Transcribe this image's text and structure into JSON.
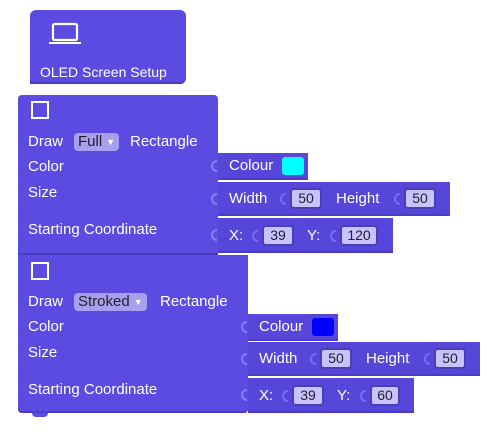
{
  "setup_block": {
    "label": "OLED Screen Setup",
    "icon": "laptop-icon"
  },
  "blocks": [
    {
      "draw_label": "Draw",
      "mode": "Full",
      "shape_label": "Rectangle",
      "color_label": "Color",
      "size_label": "Size",
      "coord_label": "Starting Coordinate",
      "colour_label": "Colour",
      "colour_value": "#00ffff",
      "width_label": "Width",
      "width_value": "50",
      "height_label": "Height",
      "height_value": "50",
      "x_label": "X:",
      "x_value": "39",
      "y_label": "Y:",
      "y_value": "120"
    },
    {
      "draw_label": "Draw",
      "mode": "Stroked",
      "shape_label": "Rectangle",
      "color_label": "Color",
      "size_label": "Size",
      "coord_label": "Starting Coordinate",
      "colour_label": "Colour",
      "colour_value": "#0000ff",
      "width_label": "Width",
      "width_value": "50",
      "height_label": "Height",
      "height_value": "50",
      "x_label": "X:",
      "x_value": "39",
      "y_label": "Y:",
      "y_value": "60"
    }
  ],
  "dropdown_arrow": "▼",
  "colors": {
    "block": "#5b4be0",
    "input": "#c8c2ff",
    "dropdown": "#a89ff0"
  }
}
